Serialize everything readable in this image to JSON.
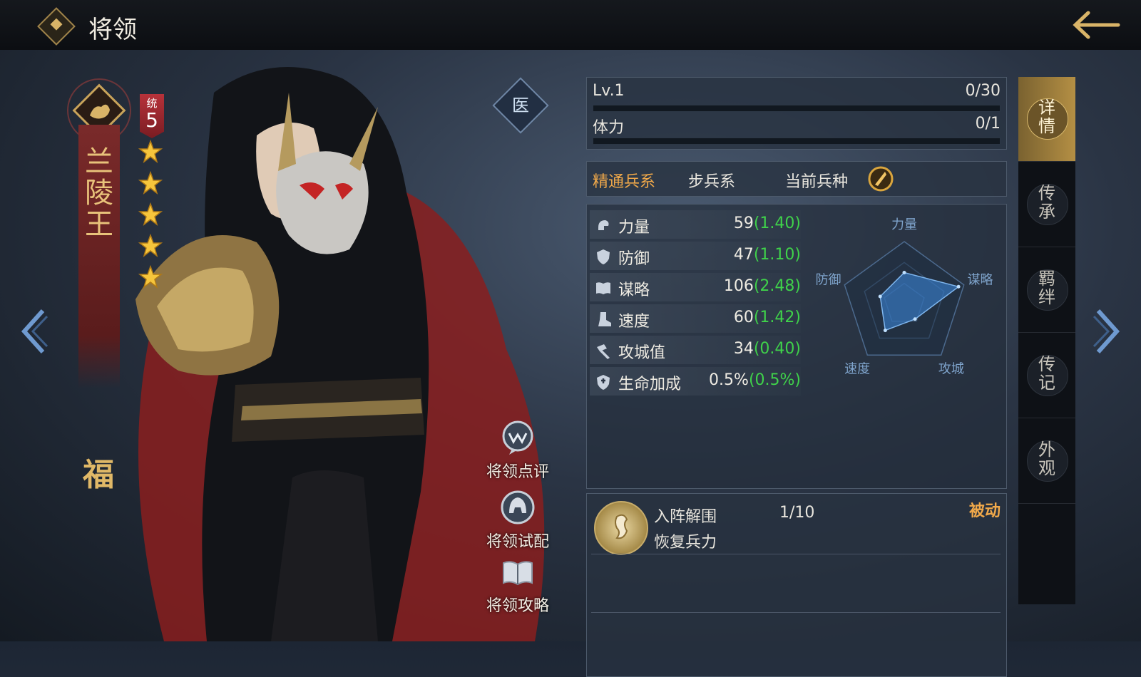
{
  "header": {
    "title": "将领"
  },
  "general": {
    "name": "兰陵王",
    "lead_label": "统",
    "lead_value": "5",
    "stars": 5,
    "blessing": "福"
  },
  "actions": {
    "doctor": "医",
    "review": "将领点评",
    "tryout": "将领试配",
    "guide": "将领攻略"
  },
  "level": {
    "label": "Lv.1",
    "exp": "0/30",
    "stamina_label": "体力",
    "stamina": "0/1"
  },
  "troop": {
    "mastery_label": "精通兵系",
    "mastery_value": "步兵系",
    "current_label": "当前兵种"
  },
  "stats": [
    {
      "name": "力量",
      "value": "59",
      "growth": "(1.40)",
      "icon": "fist-icon"
    },
    {
      "name": "防御",
      "value": "47",
      "growth": "(1.10)",
      "icon": "shield-icon"
    },
    {
      "name": "谋略",
      "value": "106",
      "growth": "(2.48)",
      "icon": "book-icon"
    },
    {
      "name": "速度",
      "value": "60",
      "growth": "(1.42)",
      "icon": "boot-icon"
    },
    {
      "name": "攻城值",
      "value": "34",
      "growth": "(0.40)",
      "icon": "hammer-icon"
    },
    {
      "name": "生命加成",
      "value": "0.5%",
      "growth": "(0.5%)",
      "icon": "heart-shield-icon"
    }
  ],
  "radar": {
    "labels": [
      "力量",
      "谋略",
      "攻城",
      "速度",
      "防御"
    ],
    "values": [
      59,
      106,
      34,
      60,
      47
    ]
  },
  "skill": {
    "name": "入阵解围",
    "level": "1/10",
    "desc": "恢复兵力",
    "type": "被动"
  },
  "tabs": [
    {
      "label": "详情",
      "active": true
    },
    {
      "label": "传承",
      "active": false
    },
    {
      "label": "羁绊",
      "active": false
    },
    {
      "label": "传记",
      "active": false
    },
    {
      "label": "外观",
      "active": false
    }
  ],
  "colors": {
    "gold": "#d9b468",
    "growth_green": "#3fd24a",
    "passive_orange": "#f1a94a",
    "banner_red": "#7a2a2a"
  }
}
